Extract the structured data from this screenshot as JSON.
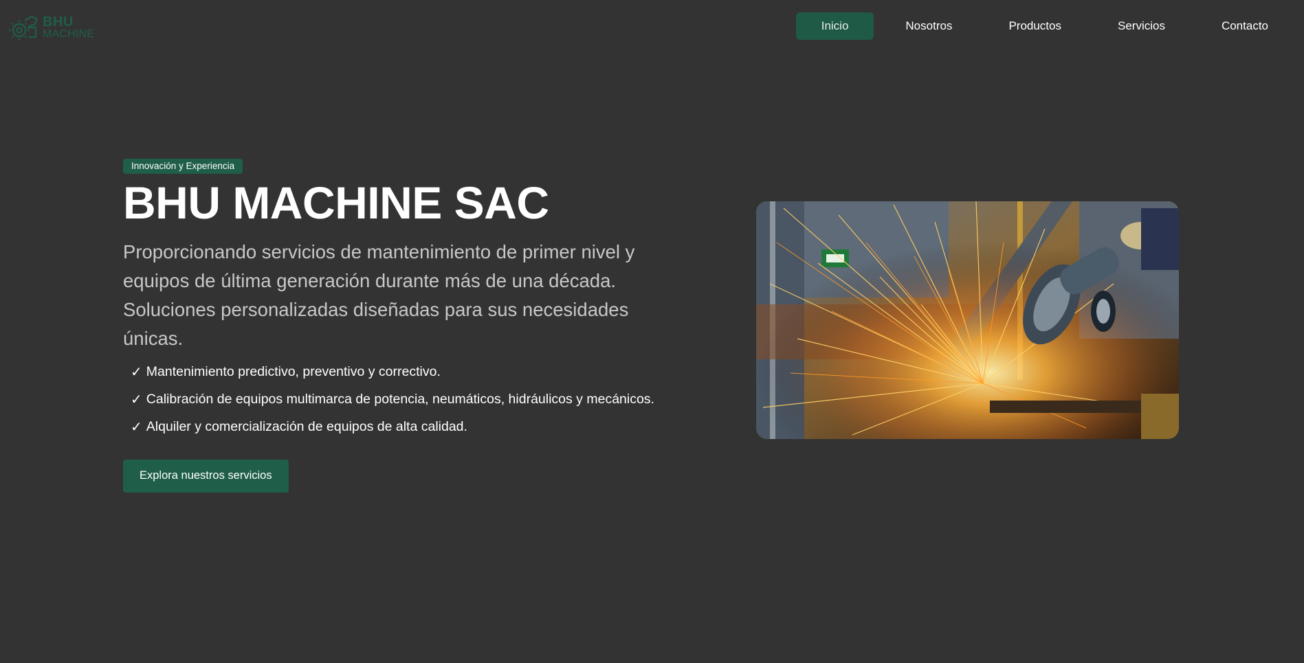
{
  "brand": {
    "line1": "BHU",
    "line2": "MACHINE",
    "icon": "machine-gear-icon",
    "color": "#1f5e49"
  },
  "nav": {
    "items": [
      {
        "label": "Inicio",
        "active": true
      },
      {
        "label": "Nosotros",
        "active": false
      },
      {
        "label": "Productos",
        "active": false
      },
      {
        "label": "Servicios",
        "active": false
      },
      {
        "label": "Contacto",
        "active": false
      }
    ]
  },
  "hero": {
    "badge": "Innovación y Experiencia",
    "title": "BHU MACHINE SAC",
    "description": "Proporcionando servicios de mantenimiento de primer nivel y equipos de última generación durante más de una década. Soluciones personalizadas diseñadas para sus necesidades únicas.",
    "features": [
      {
        "check": "✓",
        "text": "Mantenimiento predictivo, preventivo y correctivo."
      },
      {
        "check": "✓",
        "text": "Calibración de equipos multimarca de potencia, neumáticos, hidráulicos y mecánicos."
      },
      {
        "check": "✓",
        "text": "Alquiler y comercialización de equipos de alta calidad."
      }
    ],
    "cta_label": "Explora nuestros servicios",
    "image": "angle-grinder-sparks-photo"
  },
  "colors": {
    "background": "#333333",
    "accent": "#1f5e49",
    "text": "#ffffff",
    "muted_text": "#c8c8c8"
  }
}
